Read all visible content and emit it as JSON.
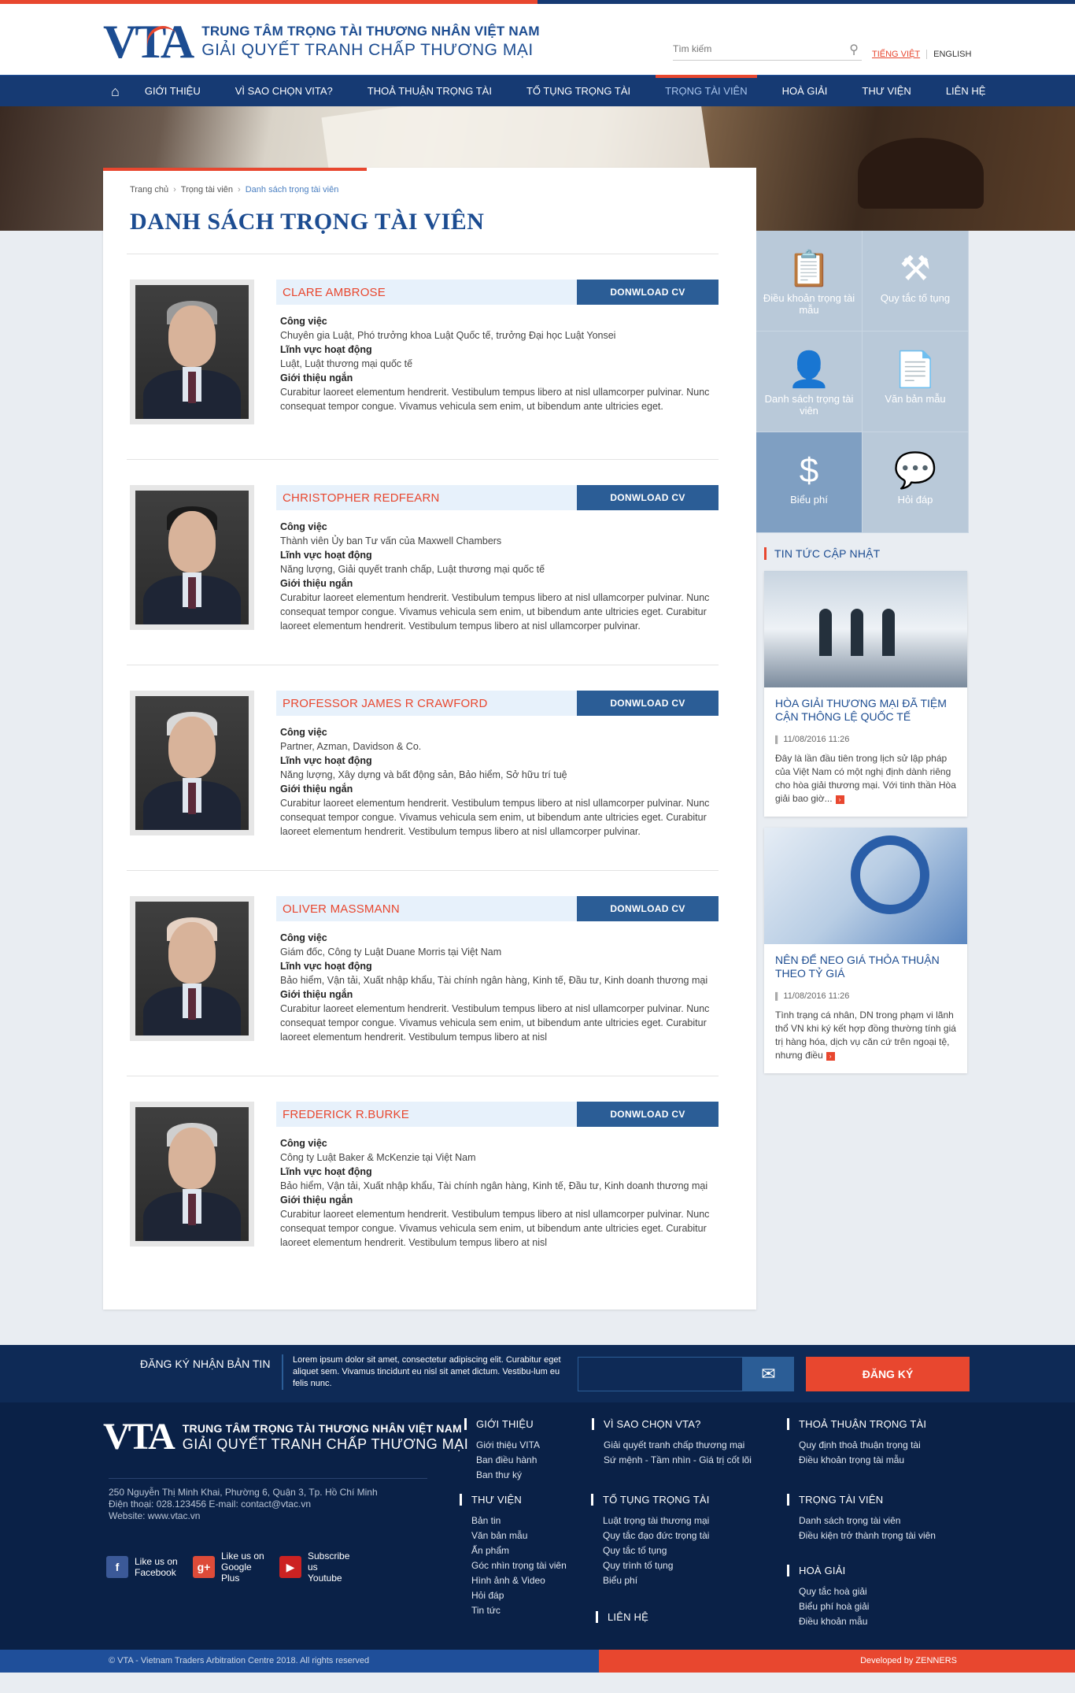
{
  "header": {
    "logo_mark": "VTA",
    "logo_line1": "TRUNG TÂM TRỌNG TÀI THƯƠNG NHÂN VIỆT NAM",
    "logo_line2": "GIẢI QUYẾT TRANH CHẤP THƯƠNG MẠI",
    "search_placeholder": "Tìm kiếm",
    "lang_vi": "TIẾNG VIỆT",
    "lang_en": "ENGLISH"
  },
  "nav": {
    "items": [
      "GIỚI THIỆU",
      "VÌ SAO CHỌN VITA?",
      "THOẢ THUẬN TRỌNG TÀI",
      "TỐ TỤNG TRỌNG TÀI",
      "TRỌNG TÀI VIÊN",
      "HOÀ GIẢI",
      "THƯ VIỆN",
      "LIÊN HỆ"
    ],
    "active_index": 4
  },
  "breadcrumb": [
    "Trang chủ",
    "Trọng tài viên",
    "Danh sách trọng tài viên"
  ],
  "page_title": "DANH SÁCH TRỌNG TÀI VIÊN",
  "labels": {
    "job": "Công việc",
    "field": "Lĩnh vực hoạt động",
    "intro": "Giới thiệu ngắn",
    "download": "DONWLOAD CV"
  },
  "arbitrators": [
    {
      "name": "CLARE AMBROSE",
      "job": "Chuyên gia Luật, Phó trưởng khoa Luật Quốc tế, trưởng Đại học Luật Yonsei",
      "field": "Luật, Luật thương mại quốc tế",
      "intro": "Curabitur laoreet elementum hendrerit. Vestibulum tempus libero at nisl ullamcorper pulvinar. Nunc consequat tempor congue. Vivamus vehicula sem enim, ut bibendum ante ultricies eget."
    },
    {
      "name": "CHRISTOPHER REDFEARN",
      "job": "Thành viên Ủy ban Tư vấn của Maxwell Chambers",
      "field": "Năng lượng, Giải quyết tranh chấp, Luật thương mại quốc tế",
      "intro": "Curabitur laoreet elementum hendrerit. Vestibulum tempus libero at nisl ullamcorper pulvinar. Nunc consequat tempor congue. Vivamus vehicula sem enim, ut bibendum ante ultricies eget.  Curabitur laoreet elementum hendrerit. Vestibulum tempus libero at nisl ullamcorper pulvinar."
    },
    {
      "name": "PROFESSOR JAMES R CRAWFORD",
      "job": "Partner, Azman, Davidson & Co.",
      "field": "Năng lượng, Xây dựng và bất động sản, Bảo hiểm, Sở hữu trí tuệ",
      "intro": "Curabitur laoreet elementum hendrerit. Vestibulum tempus libero at nisl ullamcorper pulvinar. Nunc consequat tempor congue. Vivamus vehicula sem enim, ut bibendum ante ultricies eget.  Curabitur laoreet elementum hendrerit. Vestibulum tempus libero at nisl ullamcorper pulvinar."
    },
    {
      "name": "OLIVER MASSMANN",
      "job": "Giám đốc, Công ty Luật Duane Morris tại Việt Nam",
      "field": "Bảo hiểm, Vận tải, Xuất nhập khẩu, Tài chính ngân hàng, Kinh tế, Đầu tư, Kinh doanh thương mại",
      "intro": "Curabitur laoreet elementum hendrerit. Vestibulum tempus libero at nisl ullamcorper pulvinar. Nunc consequat tempor congue. Vivamus vehicula sem enim, ut bibendum ante ultricies eget.  Curabitur laoreet elementum hendrerit. Vestibulum tempus libero at nisl"
    },
    {
      "name": "FREDERICK R.BURKE",
      "job": "Công ty Luật Baker & McKenzie tại Việt Nam",
      "field": "Bảo hiểm, Vận tải, Xuất nhập khẩu, Tài chính ngân hàng, Kinh tế, Đầu tư, Kinh doanh thương mại",
      "intro": "Curabitur laoreet elementum hendrerit. Vestibulum tempus libero at nisl ullamcorper pulvinar. Nunc consequat tempor congue. Vivamus vehicula sem enim, ut bibendum ante ultricies eget.  Curabitur laoreet elementum hendrerit. Vestibulum tempus libero at nisl"
    }
  ],
  "sidebar": {
    "tiles": [
      {
        "label": "Điều khoản trọng tài mẫu",
        "icon": "clipboard-icon"
      },
      {
        "label": "Quy tắc tố tụng",
        "icon": "gavel-icon"
      },
      {
        "label": "Danh sách trọng tài viên",
        "icon": "person-icon"
      },
      {
        "label": "Văn bản mẫu",
        "icon": "document-icon"
      },
      {
        "label": "Biểu phí",
        "icon": "fee-icon"
      },
      {
        "label": "Hỏi đáp",
        "icon": "qa-icon"
      }
    ],
    "active_tile": 4,
    "news_heading": "TIN TỨC CẬP NHẬT",
    "news": [
      {
        "title": "HÒA GIẢI THƯƠNG MẠI ĐÃ TIỆM CẬN THÔNG LỆ QUỐC TẾ",
        "date": "11/08/2016 11:26",
        "desc": "Đây là lần đầu tiên trong lịch sử lập pháp của Việt Nam có một nghị định dành riêng cho hòa giải thương mại. Với tinh thần Hòa giải bao giờ..."
      },
      {
        "title": "NÊN ĐỂ NEO GIÁ THỎA THUẬN THEO TỶ GIÁ",
        "date": "11/08/2016 11:26",
        "desc": "Tình trạng cá nhân, DN trong phạm vi lãnh thổ VN khi ký kết hợp đồng thường tính giá trị hàng hóa, dịch vụ căn cứ trên ngoại tệ, nhưng điều"
      }
    ]
  },
  "subscribe": {
    "label": "ĐĂNG KÝ NHẬN BẢN TIN",
    "text": "Lorem ipsum dolor sit amet, consectetur adipiscing elit. Curabitur eget aliquet sem. Vivamus tincidunt eu nisl sit amet dictum. Vestibu-lum eu felis nunc.",
    "button": "ĐĂNG KÝ"
  },
  "footer": {
    "logo_line1": "TRUNG TÂM TRỌNG TÀI THƯƠNG NHÂN VIỆT NAM",
    "logo_line2": "GIẢI QUYẾT TRANH CHẤP THƯƠNG MẠI",
    "address": "250 Nguyễn Thị Minh Khai, Phường 6, Quận 3, Tp. Hồ Chí Minh",
    "phone": "Điện thoại: 028.123456 E-mail: contact@vtac.vn",
    "website": "Website: www.vtac.vn",
    "socials": [
      {
        "line1": "Like us on",
        "line2": "Facebook",
        "color": "#3b5998",
        "glyph": "f"
      },
      {
        "line1": "Like us on",
        "line2": "Google Plus",
        "color": "#dd4b39",
        "glyph": "g+"
      },
      {
        "line1": "Subscribe us",
        "line2": "Youtube",
        "color": "#cc2222",
        "glyph": "▶"
      }
    ],
    "columns": [
      {
        "heading": "GIỚI THIỆU",
        "links": [
          "Giới thiệu VITA",
          "Ban điều hành",
          "Ban thư ký"
        ]
      },
      {
        "heading": "VÌ SAO CHỌN VTA?",
        "links": [
          "Giải quyết tranh chấp thương mại",
          "Sứ mệnh - Tầm  nhìn - Giá trị cốt lõi"
        ]
      },
      {
        "heading": "THOẢ THUẬN TRỌNG TÀI",
        "links": [
          "Quy định thoả thuận trọng tài",
          "Điều khoản trọng tài mẫu"
        ]
      },
      {
        "heading": "THƯ VIỆN",
        "links": [
          "Bản tin",
          "Văn bản mẫu",
          "Ấn phẩm",
          "Góc nhìn trọng tài viên",
          "Hình ảnh & Video",
          "Hỏi đáp",
          "Tin tức"
        ]
      },
      {
        "heading": "TỐ TỤNG TRỌNG TÀI",
        "links": [
          "Luật trọng tài thương mại",
          "Quy tắc đạo đức trọng tài",
          "Quy tắc tố tụng",
          "Quy trình tố tụng",
          "Biểu phí"
        ]
      },
      {
        "heading": "LIÊN HỆ",
        "links": []
      },
      {
        "heading": "TRỌNG TÀI VIÊN",
        "links": [
          "Danh sách trọng tài viên",
          "Điều kiện trở thành trọng tài viên"
        ]
      },
      {
        "heading": "HOÀ GIẢI",
        "links": [
          "Quy tắc hoà giải",
          "Biểu phí hoà giải",
          "Điều khoản mẫu"
        ]
      }
    ],
    "copyright": "© VTA - Vietnam Traders Arbitration Centre  2018. All rights reserved",
    "developer": "Developed by ZENNERS"
  }
}
